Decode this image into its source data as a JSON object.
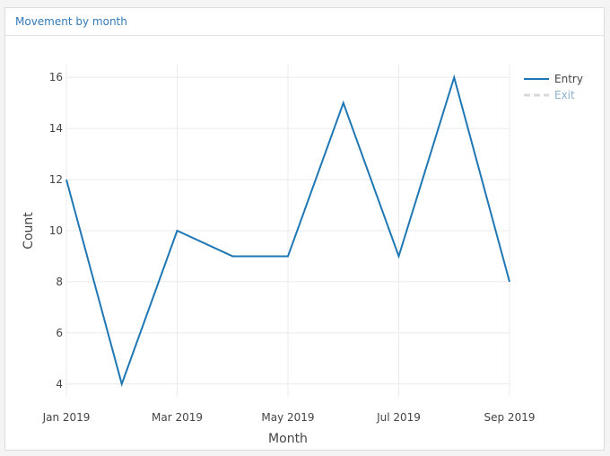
{
  "panel": {
    "title": "Movement by month"
  },
  "chart_data": {
    "type": "line",
    "xlabel": "Month",
    "ylabel": "Count",
    "x": [
      "2019-01",
      "2019-02",
      "2019-03",
      "2019-04",
      "2019-05",
      "2019-06",
      "2019-07",
      "2019-08",
      "2019-09"
    ],
    "x_ticks": [
      "2019-01",
      "2019-03",
      "2019-05",
      "2019-07",
      "2019-09"
    ],
    "x_tick_labels": [
      "Jan 2019",
      "Mar 2019",
      "May 2019",
      "Jul 2019",
      "Sep 2019"
    ],
    "y_ticks": [
      4,
      6,
      8,
      10,
      12,
      14,
      16
    ],
    "ylim": [
      3.5,
      16.5
    ],
    "grid": true,
    "legend_position": "top-right",
    "series": [
      {
        "name": "Entry",
        "values": [
          12,
          4,
          10,
          9,
          9,
          15,
          9,
          16,
          8
        ],
        "color": "#1f77b4",
        "visible": true
      },
      {
        "name": "Exit",
        "values": [],
        "color": "#a6c1d6",
        "visible": false
      }
    ]
  }
}
